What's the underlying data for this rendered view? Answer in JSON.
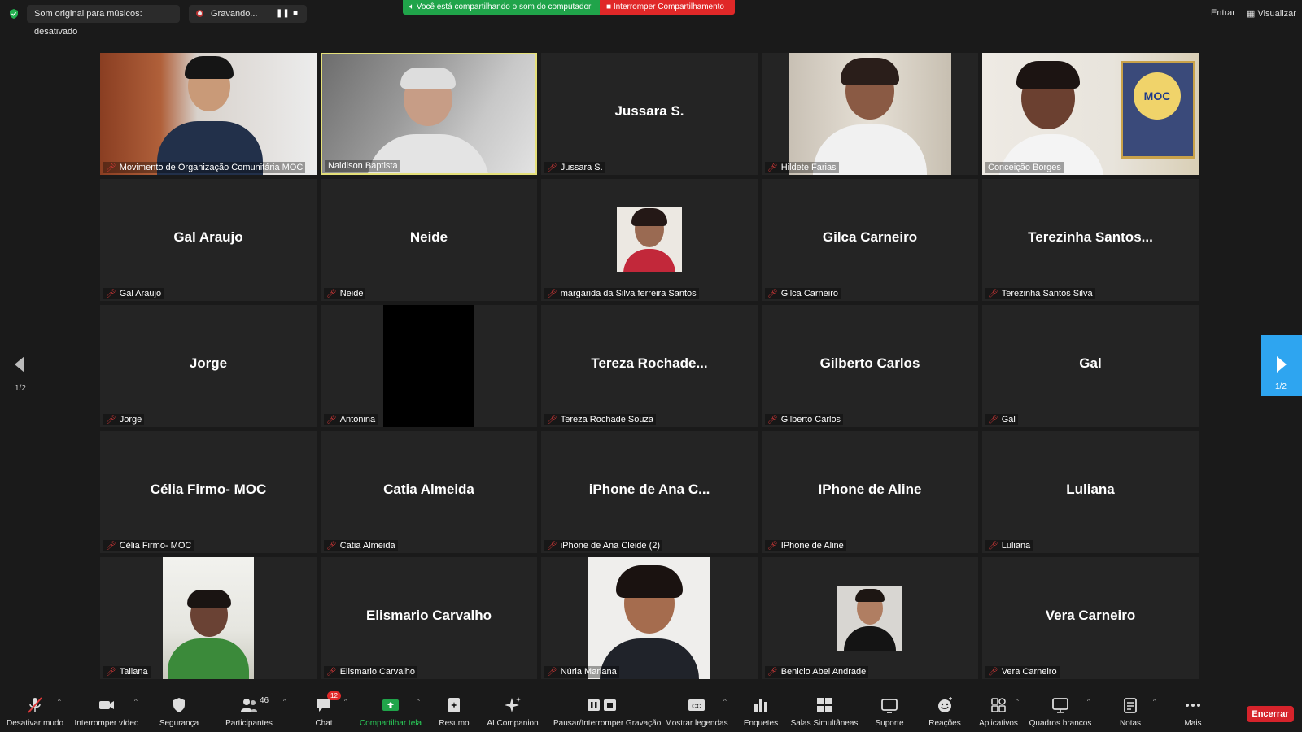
{
  "topbar": {
    "original_sound": "Som original para músicos: desativado",
    "recording": "Gravando...",
    "sharing_message": "Você está compartilhando o som do computador",
    "stop_sharing": "Interromper Compartilhamento",
    "enter": "Entrar",
    "view": "Visualizar"
  },
  "pagination": {
    "left": "1/2",
    "right": "1/2"
  },
  "tiles": [
    {
      "label": "Movimento de Organização Comunitária MOC",
      "big": ""
    },
    {
      "label": "Naidison Baptista",
      "big": ""
    },
    {
      "label": "Jussara S.",
      "big": "Jussara S."
    },
    {
      "label": "Hildete Farias",
      "big": ""
    },
    {
      "label": "Conceição Borges",
      "big": ""
    },
    {
      "label": "Gal Araujo",
      "big": "Gal Araujo"
    },
    {
      "label": "Neide",
      "big": "Neide"
    },
    {
      "label": "margarida da Silva ferreira Santos",
      "big": ""
    },
    {
      "label": "Gilca Carneiro",
      "big": "Gilca Carneiro"
    },
    {
      "label": "Terezinha Santos Silva",
      "big": "Terezinha  Santos..."
    },
    {
      "label": "Jorge",
      "big": "Jorge"
    },
    {
      "label": "Antonina",
      "big": ""
    },
    {
      "label": "Tereza Rochade Souza",
      "big": "Tereza  Rochade..."
    },
    {
      "label": "Gilberto Carlos",
      "big": "Gilberto Carlos"
    },
    {
      "label": "Gal",
      "big": "Gal"
    },
    {
      "label": "Célia Firmo- MOC",
      "big": "Célia Firmo- MOC"
    },
    {
      "label": "Catia Almeida",
      "big": "Catia Almeida"
    },
    {
      "label": "iPhone de Ana Cleide (2)",
      "big": "iPhone de Ana C..."
    },
    {
      "label": "IPhone de Aline",
      "big": "IPhone de Aline"
    },
    {
      "label": "Luliana",
      "big": "Luliana"
    },
    {
      "label": "Tailana",
      "big": ""
    },
    {
      "label": "Elismario Carvalho",
      "big": "Elismario Carvalho"
    },
    {
      "label": "Núria Mariana",
      "big": ""
    },
    {
      "label": "Benicio Abel Andrade",
      "big": ""
    },
    {
      "label": "Vera Carneiro",
      "big": "Vera Carneiro"
    }
  ],
  "toolbar": {
    "unmute": "Desativar mudo",
    "stop_video": "Interromper vídeo",
    "security": "Segurança",
    "participants": "Participantes",
    "participants_count": "46",
    "chat": "Chat",
    "chat_badge": "12",
    "share_screen": "Compartilhar tela",
    "summary": "Resumo",
    "ai_companion": "AI Companion",
    "pause_recording": "Pausar/Interromper Gravação",
    "captions": "Mostrar legendas",
    "polls": "Enquetes",
    "breakout": "Salas Simultâneas",
    "support": "Suporte",
    "reactions": "Reações",
    "apps": "Aplicativos",
    "whiteboards": "Quadros brancos",
    "notes": "Notas",
    "more": "Mais",
    "end": "Encerrar"
  },
  "colors": {
    "share_green": "#20a44a",
    "stop_red": "#e02828",
    "active_speaker": "#e5e07a",
    "nav_blue": "#2ea5f0"
  }
}
